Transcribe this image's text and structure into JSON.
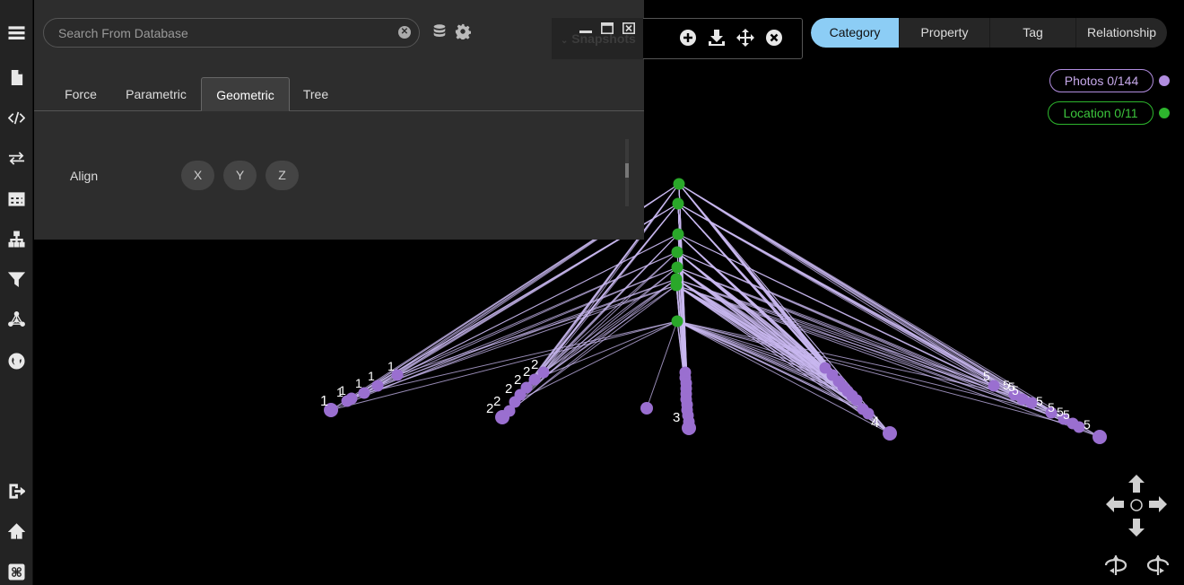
{
  "search": {
    "placeholder": "Search From Database"
  },
  "panel": {
    "tabs": [
      "Force",
      "Parametric",
      "Geometric",
      "Tree"
    ],
    "active_tab": "Geometric",
    "align_label": "Align",
    "align_axes": [
      "X",
      "Y",
      "Z"
    ]
  },
  "snapshots": {
    "title": "Snapshots"
  },
  "modes": {
    "tabs": [
      "Category",
      "Property",
      "Tag",
      "Relationship"
    ],
    "active": "Category"
  },
  "legend": [
    {
      "label": "Photos 0/144",
      "color": "#b18ddf"
    },
    {
      "label": "Location 0/11",
      "color": "#2db52d"
    }
  ],
  "colors": {
    "accent": "#8ccdf5",
    "node_photo": "#9a6fd0",
    "node_location": "#2aa82a",
    "edge": "#c9b8f0"
  },
  "sidebar_icons": [
    "menu-icon",
    "document-icon",
    "code-icon",
    "transfer-icon",
    "table-icon",
    "hierarchy-icon",
    "filter-icon",
    "network-icon",
    "globe-icon",
    "logout-icon",
    "home-icon",
    "command-icon"
  ],
  "graph_labels": {
    "cluster1": [
      "1",
      "1",
      "1",
      "1",
      "1",
      "1"
    ],
    "cluster2": [
      "2",
      "2",
      "2",
      "2",
      "2",
      "2"
    ],
    "cluster3": [
      "3"
    ],
    "cluster4": [
      "4"
    ],
    "cluster5": [
      "5",
      "5",
      "5",
      "5",
      "5",
      "5",
      "5",
      "5",
      "5"
    ]
  }
}
